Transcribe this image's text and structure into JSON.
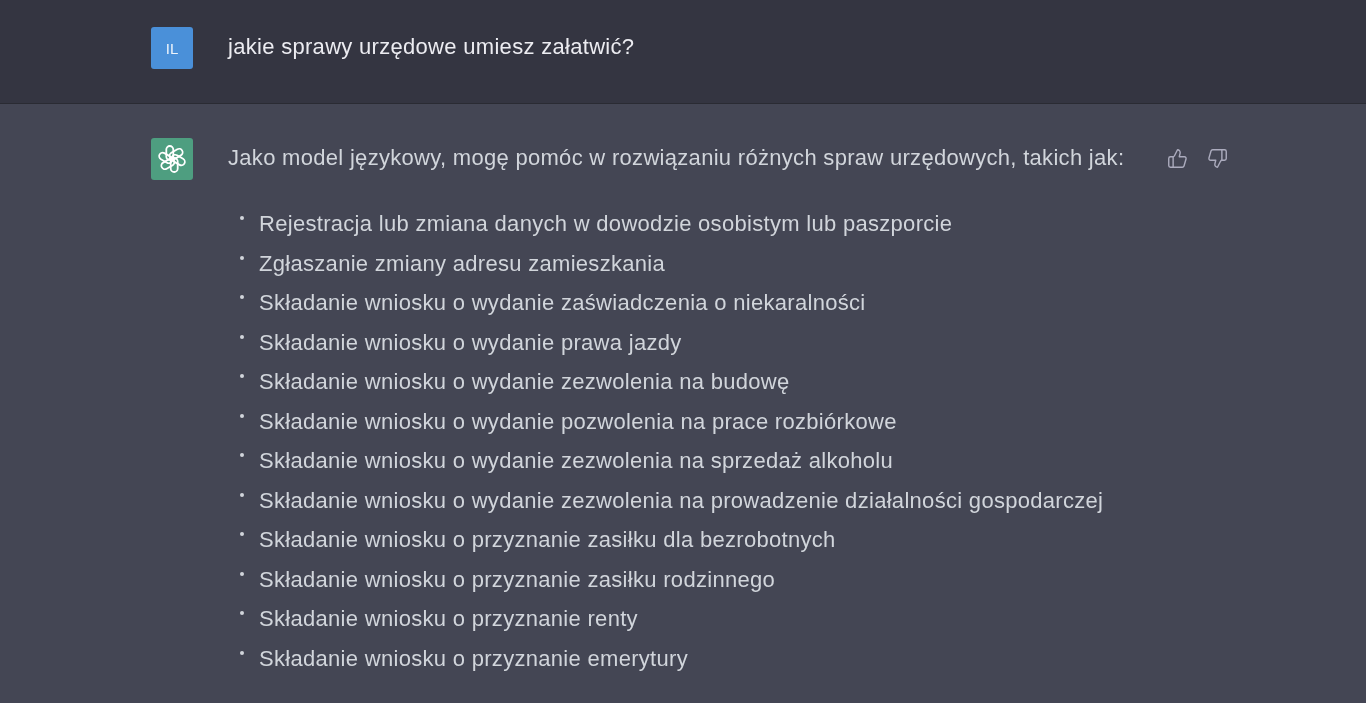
{
  "messages": [
    {
      "kind": "user",
      "avatar_initials": "IL",
      "text": "jakie sprawy urzędowe umiesz załatwić?"
    },
    {
      "kind": "assistant",
      "text": "Jako model językowy, mogę pomóc w rozwiązaniu różnych spraw urzędowych, takich jak:",
      "items": [
        "Rejestracja lub zmiana danych w dowodzie osobistym lub paszporcie",
        "Zgłaszanie zmiany adresu zamieszkania",
        "Składanie wniosku o wydanie zaświadczenia o niekaralności",
        "Składanie wniosku o wydanie prawa jazdy",
        "Składanie wniosku o wydanie zezwolenia na budowę",
        "Składanie wniosku o wydanie pozwolenia na prace rozbiórkowe",
        "Składanie wniosku o wydanie zezwolenia na sprzedaż alkoholu",
        "Składanie wniosku o wydanie zezwolenia na prowadzenie działalności gospodarczej",
        "Składanie wniosku o przyznanie zasiłku dla bezrobotnych",
        "Składanie wniosku o przyznanie zasiłku rodzinnego",
        "Składanie wniosku o przyznanie renty",
        "Składanie wniosku o przyznanie emerytury"
      ]
    }
  ]
}
